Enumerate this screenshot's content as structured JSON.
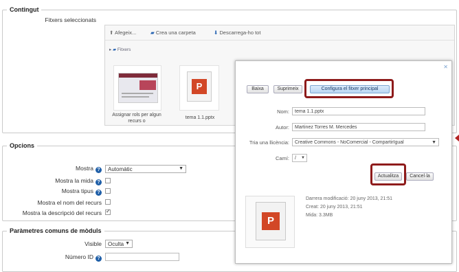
{
  "sections": {
    "contingut": "Contingut",
    "opcions": "Opcions",
    "parametres": "Paràmetres comuns de mòduls"
  },
  "contingut": {
    "fitxers_label": "Fitxers seleccionats",
    "toolbar": {
      "add": "Afegeix...",
      "create_folder": "Crea una carpeta",
      "download": "Descarrega-ho tot"
    },
    "path": "Fitxers",
    "files": [
      {
        "name": "Assignar rols per algun recurs o"
      },
      {
        "name": "tema 1.1.pptx"
      }
    ]
  },
  "opcions": {
    "mostra": {
      "label": "Mostra",
      "value": "Automàtic"
    },
    "mostra_mida": {
      "label": "Mostra la mida",
      "checked": false
    },
    "mostra_tipus": {
      "label": "Mostra tipus",
      "checked": false
    },
    "mostra_nom": {
      "label": "Mostra el nom del recurs",
      "checked": false
    },
    "mostra_desc": {
      "label": "Mostra la descripció del recurs",
      "checked": true
    }
  },
  "parametres": {
    "visible": {
      "label": "Visible",
      "value": "Oculta"
    },
    "numero_id": {
      "label": "Número ID",
      "value": ""
    }
  },
  "dialog": {
    "buttons": {
      "download": "Baixa",
      "delete": "Suprimeix",
      "main_file": "Configura el fitxer principal",
      "update": "Actualitza",
      "cancel": "Cancel·la"
    },
    "fields": {
      "name": {
        "label": "Nom:",
        "value": "tema 1.1.pptx"
      },
      "author": {
        "label": "Autor:",
        "value": "Martinez Torres M. Mercedes"
      },
      "license": {
        "label": "Tria una llicència:",
        "value": "Creative Commons - NoComercial - CompartirIgual"
      },
      "path": {
        "label": "Camí:",
        "value": "/"
      }
    },
    "meta": {
      "modified": "Darrera modificació: 20 juny 2013, 21:51",
      "created": "Creat: 20 juny 2013, 21:51",
      "size": "Mida: 3.3MB"
    },
    "colors": {
      "highlight": "#8e1b1b",
      "primary_button": "#b9d6f3"
    }
  }
}
